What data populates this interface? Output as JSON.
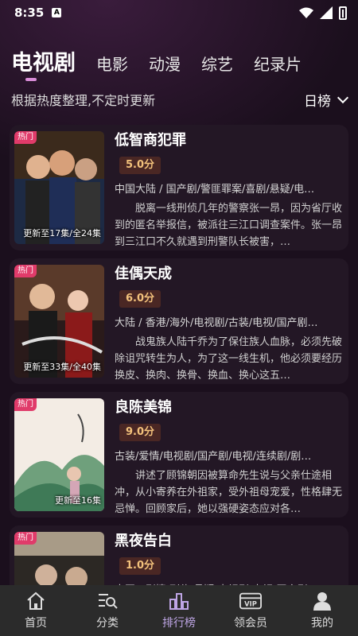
{
  "status_bar": {
    "time": "8:35",
    "notif_letter": "A"
  },
  "tabs": [
    {
      "label": "电视剧",
      "active": true
    },
    {
      "label": "电影"
    },
    {
      "label": "动漫"
    },
    {
      "label": "综艺"
    },
    {
      "label": "纪录片"
    }
  ],
  "subheader": {
    "note": "根据热度整理,不定时更新",
    "ranking_selector": "日榜"
  },
  "hot_badge": "热门",
  "shows": [
    {
      "title": "低智商犯罪",
      "score": "5.0分",
      "episodes": "更新至17集/全24集",
      "tags": "中国大陆 / 国产剧/警匪罪案/喜剧/悬疑/电…",
      "desc": "脱离一线刑侦几年的警察张一昂，因为省厅收到的匿名举报信，被派往三江口调查案件。张一昂到三江口不久就遇到刑警队长被害，…"
    },
    {
      "title": "佳偶天成",
      "score": "6.0分",
      "episodes": "更新至33集/全40集",
      "tags": "大陆 / 香港/海外/电视剧/古装/电视/国产剧…",
      "desc": "战鬼族人陆千乔为了保住族人血脉，必须先破除诅咒转生为人，为了这一线生机，他必须要经历换皮、换肉、换骨、换血、换心这五…"
    },
    {
      "title": "良陈美锦",
      "score": "9.0分",
      "episodes": "更新至16集",
      "tags": "古装/爱情/电视剧/国产剧/电视/连续剧/剧…",
      "desc": "讲述了顾锦朝因被算命先生说与父亲仕途相冲，从小寄养在外祖家，受外祖母宠爱，性格肆无忌惮。回顾家后，她以强硬姿态应对各…"
    },
    {
      "title": "黑夜告白",
      "score": "1.0分",
      "episodes": "",
      "tags": "中国 / 剧情/刑侦/悬疑/电视剧/电视/国产剧…",
      "desc": ""
    }
  ],
  "bottom_nav": [
    {
      "label": "首页",
      "icon": "home-icon"
    },
    {
      "label": "分类",
      "icon": "category-search-icon"
    },
    {
      "label": "排行榜",
      "icon": "ranking-icon",
      "active": true
    },
    {
      "label": "领会员",
      "icon": "vip-icon"
    },
    {
      "label": "我的",
      "icon": "user-icon"
    }
  ]
}
